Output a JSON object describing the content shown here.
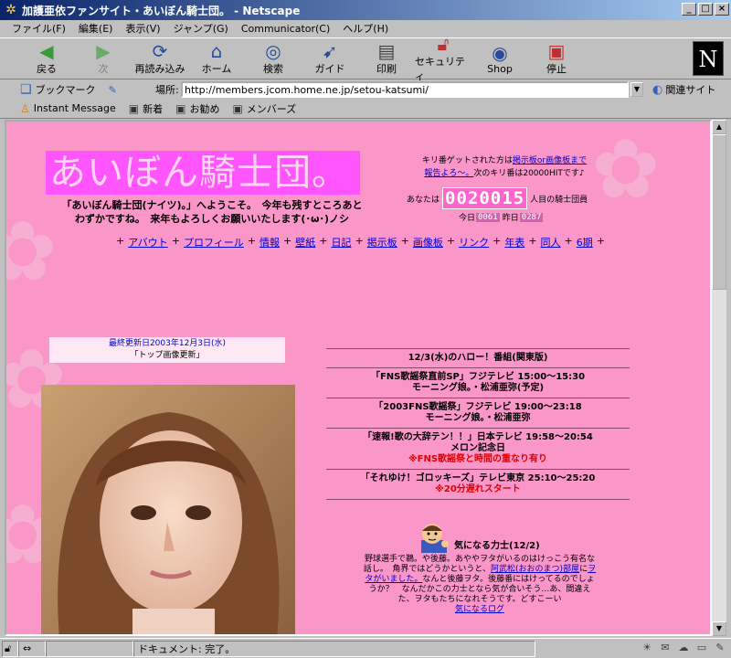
{
  "window": {
    "title": "加護亜依ファンサイト・あいぼん騎士団。 - Netscape"
  },
  "menu": [
    "ファイル(F)",
    "編集(E)",
    "表示(V)",
    "ジャンプ(G)",
    "Communicator(C)",
    "ヘルプ(H)"
  ],
  "toolbar": {
    "back": "戻る",
    "forward": "次",
    "reload": "再読み込み",
    "home": "ホーム",
    "search": "検索",
    "guide": "ガイド",
    "print": "印刷",
    "security": "セキュリティ",
    "shop": "Shop",
    "stop": "停止"
  },
  "location": {
    "bookmarks": "ブックマーク",
    "label": "場所:",
    "url": "http://members.jcom.home.ne.jp/setou-katsumi/",
    "related": "関連サイト"
  },
  "personal_toolbar": [
    "Instant Message",
    "新着",
    "お勧め",
    "メンバーズ"
  ],
  "page": {
    "site_title": "あいぼん騎士団。",
    "welcome_line1": "「あいぼん騎士団(ナイツ)。」へようこそ。　今年も残すところあと",
    "welcome_line2": "わずかですね。　来年もよろしくお願いいたします(･ω･)ノシ",
    "kiri_line1a": "キリ番ゲットされた方は",
    "kiri_link1": "掲示板or画像板まで",
    "kiri_link2": "報告よろ〜。",
    "kiri_line2b": "次のキリ番は20000HITです♪",
    "visitor_prefix": "あなたは",
    "visitor_count": "0020015",
    "visitor_suffix": "人目の騎士団員",
    "today_label": "今日",
    "today_count": "0061",
    "yesterday_label": "昨日",
    "yesterday_count": "0287",
    "nav": [
      "アバウト",
      "プロフィール",
      "情報",
      "壁紙",
      "日記",
      "掲示板",
      "画像板",
      "リンク",
      "年表",
      "同人",
      "6期"
    ],
    "update_date": "最終更新日2003年12月3日(水)",
    "update_note": "「トップ画像更新」",
    "schedule": [
      {
        "line1": "12/3(水)のハロー！番組(関東版)",
        "line2": "",
        "alert": ""
      },
      {
        "line1": "「FNS歌謡祭直前SP」フジテレビ 15:00〜15:30",
        "line2": "モーニング娘。・松浦亜弥(予定)",
        "alert": ""
      },
      {
        "line1": "「2003FNS歌謡祭」フジテレビ 19:00〜23:18",
        "line2": "モーニング娘。・松浦亜弥",
        "alert": ""
      },
      {
        "line1": "「速報!歌の大辞テン！！」日本テレビ 19:58〜20:54",
        "line2": "メロン記念日",
        "alert": "※FNS歌謡祭と時間の重なり有り"
      },
      {
        "line1": "「それゆけ！ゴロッキーズ」テレビ東京 25:10〜25:20",
        "line2": "",
        "alert": "※20分遅れスタート"
      }
    ],
    "kininaru_title": "気になる力士(12/2)",
    "kininaru_text1": "野球選手で鵜。や後藤。あややヲタがいるのはけっこう有名な話し。　角界ではどうかというと、",
    "kininaru_link1": "阿武松(おおのまつ)部屋",
    "kininaru_text2": "に",
    "kininaru_link2": "ヲタがいました。",
    "kininaru_text3": "なんと後藤ヲタ。後藤番にはけってるのでしょうか？　なんだかこの力士となら気が合いそう…あ、間違えた、ヲタもたちになれそうです。どすこーい",
    "kininaru_log": "気になるログ"
  },
  "status": {
    "text": "ドキュメント: 完了。"
  }
}
